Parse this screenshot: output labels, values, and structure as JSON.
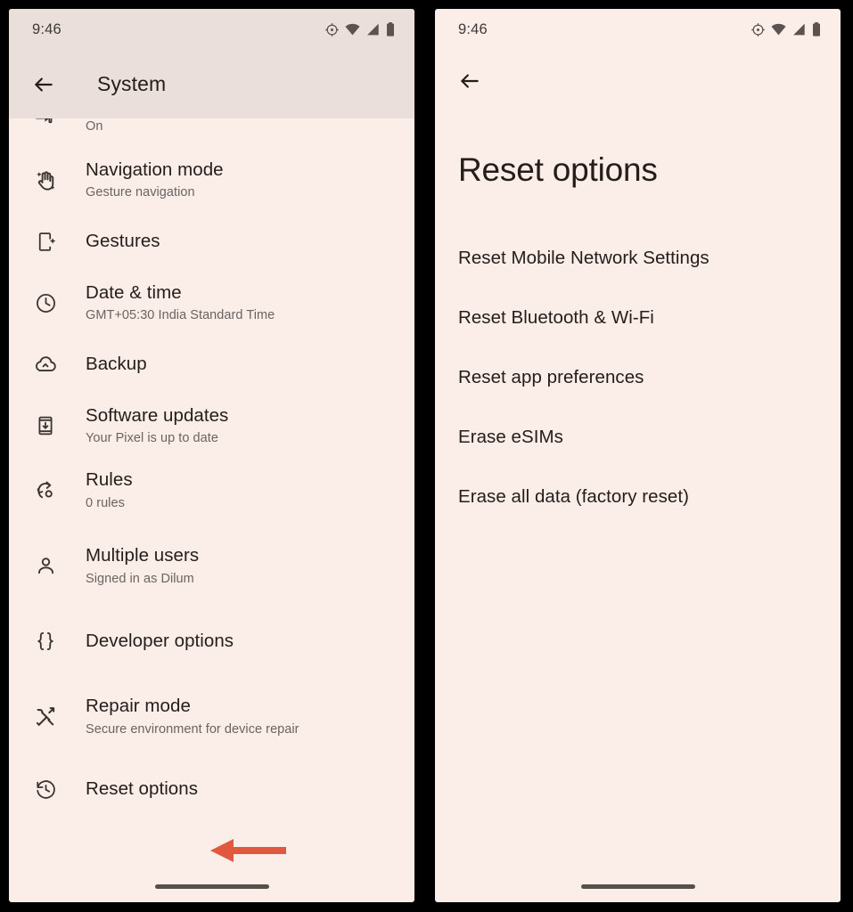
{
  "left_phone": {
    "status_bar": {
      "time": "9:46",
      "icons": [
        "alarm-icon",
        "wifi-icon",
        "signal-icon",
        "battery-icon"
      ]
    },
    "appbar": {
      "back_label": "back-arrow",
      "title": "System"
    },
    "clipped_row": {
      "subtitle": "On",
      "icon": "pointer-icon"
    },
    "items": [
      {
        "title": "Navigation mode",
        "subtitle": "Gesture navigation",
        "icon": "gesture-hand-icon"
      },
      {
        "title": "Gestures",
        "subtitle": "",
        "icon": "phone-sparkle-icon"
      },
      {
        "title": "Date & time",
        "subtitle": "GMT+05:30 India Standard Time",
        "icon": "clock-icon"
      },
      {
        "title": "Backup",
        "subtitle": "",
        "icon": "cloud-upload-icon"
      },
      {
        "title": "Software updates",
        "subtitle": "Your Pixel is up to date",
        "icon": "phone-download-icon"
      },
      {
        "title": "Rules",
        "subtitle": "0 rules",
        "icon": "rules-gear-icon"
      },
      {
        "title": "Multiple users",
        "subtitle": "Signed in as Dilum",
        "icon": "person-icon"
      },
      {
        "title": "Developer options",
        "subtitle": "",
        "icon": "braces-icon"
      },
      {
        "title": "Repair mode",
        "subtitle": "Secure environment for device repair",
        "icon": "tools-icon"
      },
      {
        "title": "Reset options",
        "subtitle": "",
        "icon": "history-restore-icon"
      }
    ]
  },
  "right_phone": {
    "status_bar": {
      "time": "9:46",
      "icons": [
        "alarm-icon",
        "wifi-icon",
        "signal-icon",
        "battery-icon"
      ]
    },
    "back_label": "back-arrow",
    "page_title": "Reset options",
    "items": [
      {
        "label": "Reset Mobile Network Settings"
      },
      {
        "label": "Reset Bluetooth & Wi-Fi"
      },
      {
        "label": "Reset app preferences"
      },
      {
        "label": "Erase eSIMs"
      },
      {
        "label": "Erase all data (factory reset)"
      }
    ]
  },
  "annotations": {
    "arrow_color": "#E0593F",
    "arrow_left_target": "Reset options",
    "arrow_right_target": "Reset Mobile Network Settings"
  },
  "colors": {
    "screen_background": "#FBEDE8",
    "appbar_background": "#EADFDB",
    "primary_text": "#241D1A",
    "secondary_text": "#6B6460",
    "bezel": "#000000",
    "home_indicator": "#55504C"
  }
}
